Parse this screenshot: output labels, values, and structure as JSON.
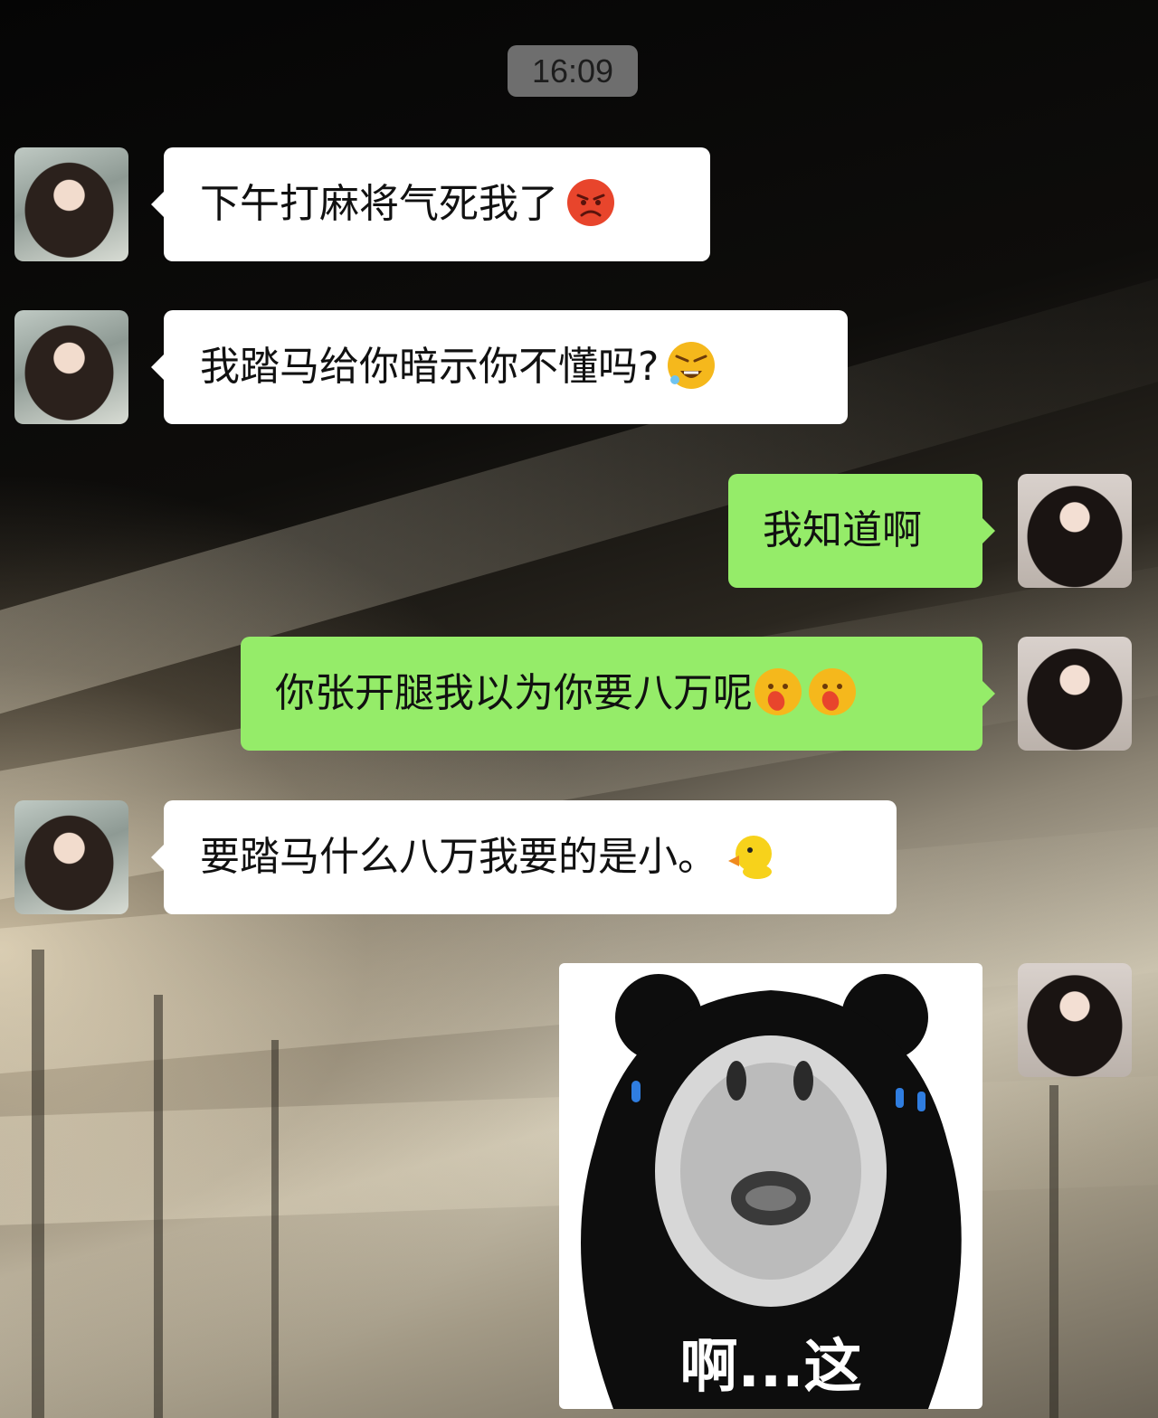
{
  "chat": {
    "timestamp": "16:09",
    "messages": [
      {
        "side": "left",
        "text": "下午打麻将气死我了",
        "emoji": "angry-face-icon"
      },
      {
        "side": "left",
        "text": "我踏马给你暗示你不懂吗?",
        "emoji": "cursing-face-icon"
      },
      {
        "side": "right",
        "text": "我知道啊"
      },
      {
        "side": "right",
        "text": "你张开腿我以为你要八万呢",
        "emoji": "face-with-hand-over-mouth-icon"
      },
      {
        "side": "left",
        "text": "要踏马什么八万我要的是小。",
        "emoji": "duck-icon"
      },
      {
        "side": "right",
        "sticker_caption": "啊...这",
        "sticker": "bear-shocked-sticker"
      }
    ]
  },
  "colors": {
    "incoming_bubble": "#ffffff",
    "outgoing_bubble": "#95ec69",
    "timestamp_pill": "#808080"
  }
}
